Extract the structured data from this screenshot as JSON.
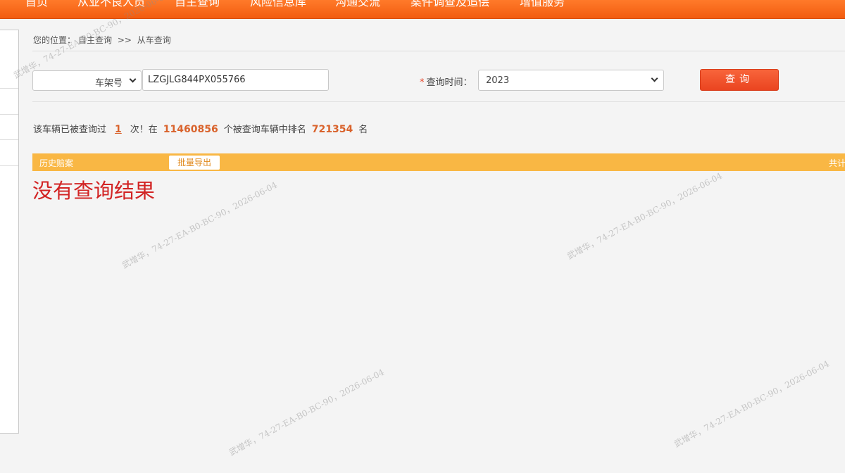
{
  "nav": {
    "items": [
      "首页",
      "从业不良人员",
      "自主查询",
      "风险信息库",
      "沟通交流",
      "案件调查及追偿",
      "增值服务"
    ]
  },
  "breadcrumb": {
    "prefix": "您的位置：",
    "level1": "自主查询",
    "separator": ">>",
    "level2": "从车查询"
  },
  "query": {
    "type_selected": "车架号",
    "vin_value": "LZGJLG844PX055766",
    "time_required_mark": "*",
    "time_label": "查询时间：",
    "year_selected": "2023",
    "search_label": "查询"
  },
  "stats": {
    "text_before": "该车辆已被查询过",
    "query_count": "1",
    "text_mid": "次！在",
    "total_vehicles": "11460856",
    "text_mid2": "个被查询车辆中排名",
    "rank": "721354",
    "text_after": "名"
  },
  "results": {
    "title": "历史赔案",
    "export_label": "批量导出",
    "total_label": "共计",
    "empty_message": "没有查询结果"
  },
  "watermark": {
    "text": "武增华，74-27-EA-B0-BC-90，2026-06-04"
  },
  "colors": {
    "nav_orange": "#f25c10",
    "result_bar": "#f9b744",
    "search_button": "#ea4420",
    "number_highlight": "#d9622b",
    "empty_message": "#d22424"
  }
}
